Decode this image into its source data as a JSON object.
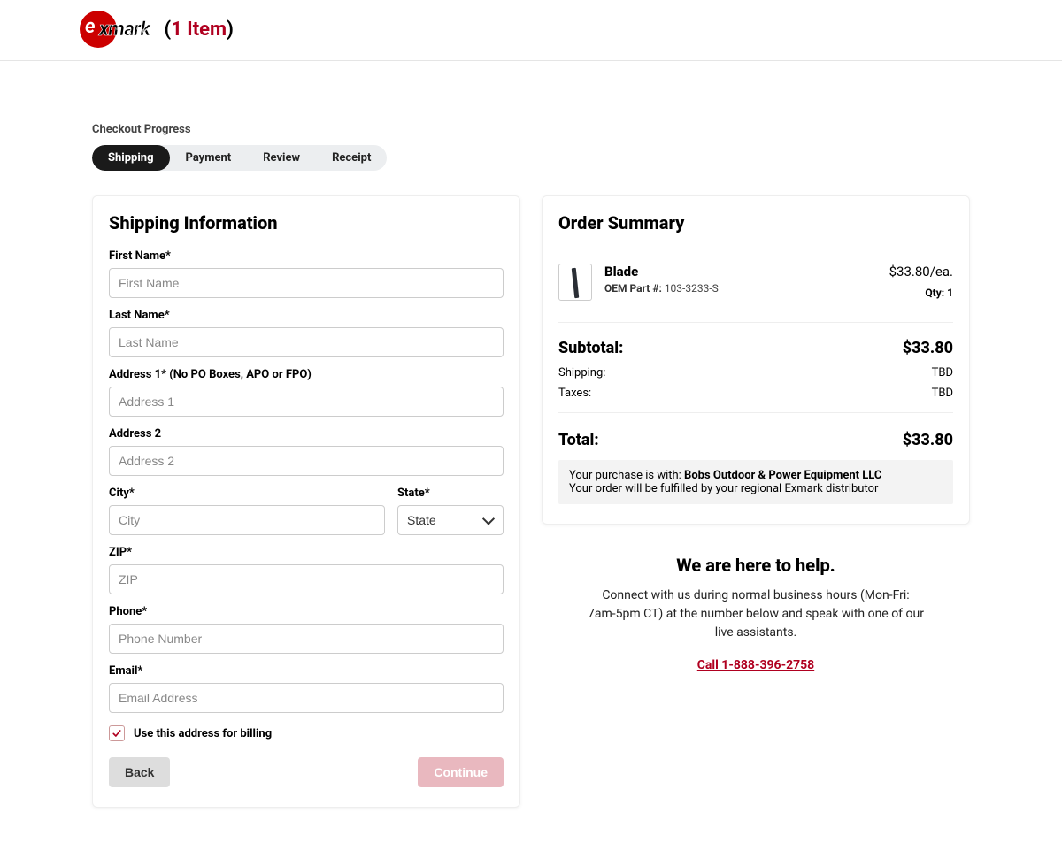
{
  "header": {
    "brand": "exmark",
    "item_count_prefix": "(",
    "item_count_text": "1 Item",
    "item_count_suffix": ")"
  },
  "progress": {
    "label": "Checkout Progress",
    "steps": [
      "Shipping",
      "Payment",
      "Review",
      "Receipt"
    ],
    "active_index": 0
  },
  "shipping_form": {
    "heading": "Shipping Information",
    "first_name": {
      "label": "First Name*",
      "placeholder": "First Name"
    },
    "last_name": {
      "label": "Last Name*",
      "placeholder": "Last Name"
    },
    "address1": {
      "label": "Address 1* (No PO Boxes, APO or FPO)",
      "placeholder": "Address 1"
    },
    "address2": {
      "label": "Address 2",
      "placeholder": "Address 2"
    },
    "city": {
      "label": "City*",
      "placeholder": "City"
    },
    "state": {
      "label": "State*",
      "placeholder": "State"
    },
    "zip": {
      "label": "ZIP*",
      "placeholder": "ZIP"
    },
    "phone": {
      "label": "Phone*",
      "placeholder": "Phone Number"
    },
    "email": {
      "label": "Email*",
      "placeholder": "Email Address"
    },
    "use_for_billing": "Use this address for billing",
    "back_btn": "Back",
    "continue_btn": "Continue"
  },
  "summary": {
    "heading": "Order Summary",
    "item": {
      "name": "Blade",
      "oem_label": "OEM Part #: ",
      "oem_num": "103-3233-S",
      "price": "$33.80/ea.",
      "qty_label": "Qty: 1"
    },
    "subtotal_label": "Subtotal:",
    "subtotal_value": "$33.80",
    "shipping_label": "Shipping:",
    "shipping_value": "TBD",
    "taxes_label": "Taxes:",
    "taxes_value": "TBD",
    "total_label": "Total:",
    "total_value": "$33.80",
    "note_prefix": "Your purchase is with: ",
    "note_dealer": "Bobs Outdoor & Power Equipment LLC",
    "note_line2": "Your order will be fulfilled by your regional Exmark distributor"
  },
  "help": {
    "heading": "We are here to help.",
    "body": "Connect with us during normal business hours (Mon-Fri: 7am-5pm CT) at the number below and speak with one of our live assistants.",
    "link_text": "Call 1-888-396-2758"
  }
}
